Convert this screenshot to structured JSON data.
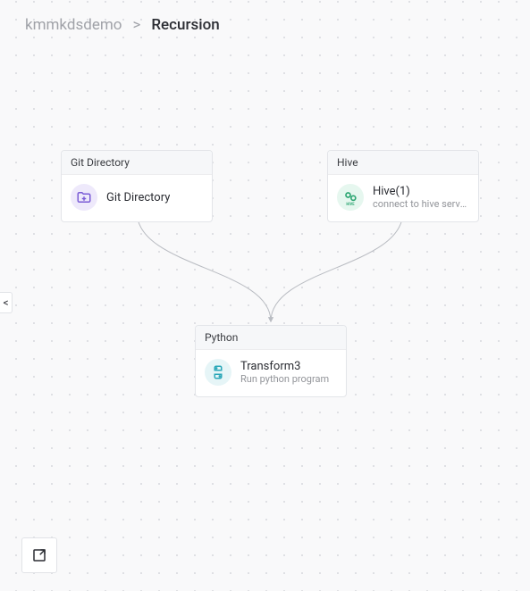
{
  "breadcrumb": {
    "root": "kmmkdsdemo",
    "separator": ">",
    "current": "Recursion"
  },
  "nodes": {
    "git": {
      "header": "Git Directory",
      "title": "Git Directory",
      "subtitle": "",
      "icon": "git-folder-icon"
    },
    "hive": {
      "header": "Hive",
      "title": "Hive(1)",
      "subtitle": "connect to hive serve...",
      "icon": "hive-icon"
    },
    "python": {
      "header": "Python",
      "title": "Transform3",
      "subtitle": "Run python program",
      "icon": "python-icon"
    }
  },
  "edges": [
    {
      "from": "git",
      "to": "python"
    },
    {
      "from": "hive",
      "to": "python"
    }
  ],
  "controls": {
    "collapse": "<",
    "expand": "expand-icon"
  }
}
